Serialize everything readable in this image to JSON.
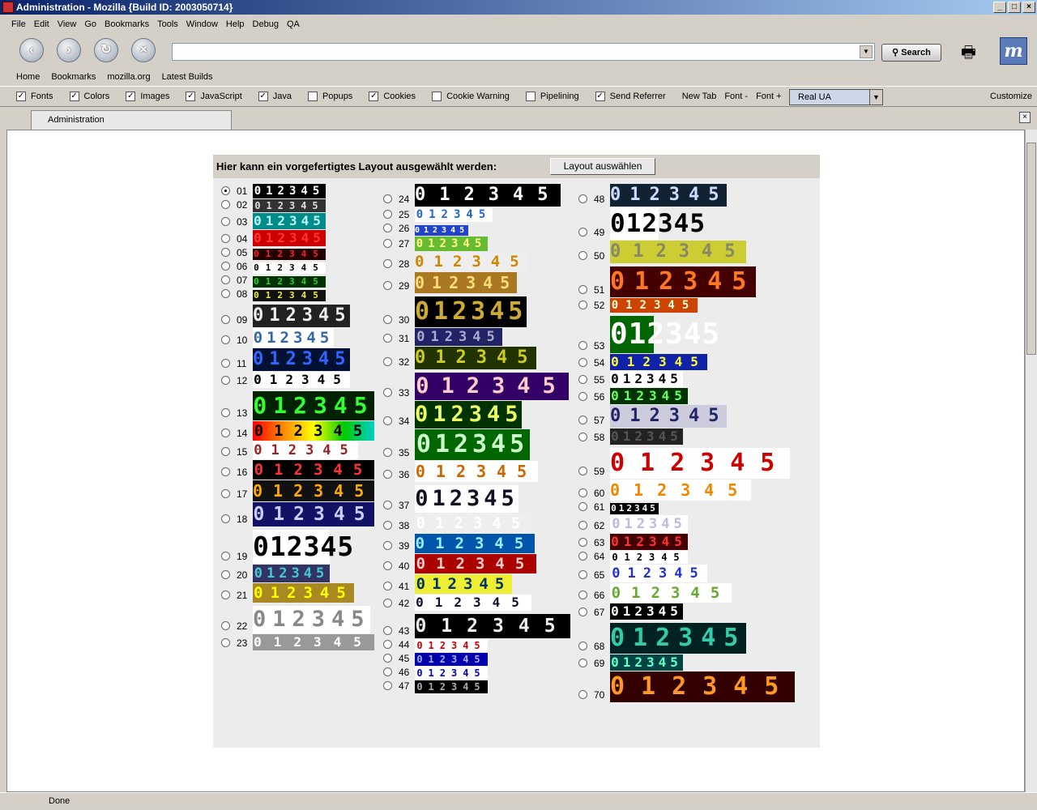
{
  "window": {
    "title": "Administration - Mozilla {Build ID: 2003050714}"
  },
  "menu": [
    "File",
    "Edit",
    "View",
    "Go",
    "Bookmarks",
    "Tools",
    "Window",
    "Help",
    "Debug",
    "QA"
  ],
  "nav": {
    "search_label": "Search"
  },
  "personal_toolbar": [
    "Home",
    "Bookmarks",
    "mozilla.org",
    "Latest Builds"
  ],
  "prefbar": {
    "checkboxes": [
      {
        "label": "Fonts",
        "checked": true
      },
      {
        "label": "Colors",
        "checked": true
      },
      {
        "label": "Images",
        "checked": true
      },
      {
        "label": "JavaScript",
        "checked": true
      },
      {
        "label": "Java",
        "checked": true
      },
      {
        "label": "Popups",
        "checked": false
      },
      {
        "label": "Cookies",
        "checked": true
      },
      {
        "label": "Cookie Warning",
        "checked": false
      },
      {
        "label": "Pipelining",
        "checked": false
      },
      {
        "label": "Send Referrer",
        "checked": true
      }
    ],
    "buttons": [
      "New Tab",
      "Font -",
      "Font +"
    ],
    "ua_select": "Real UA",
    "customize": "Customize"
  },
  "tab": {
    "label": "Administration"
  },
  "page": {
    "header_text": "Hier kann ein vorgefertigtes Layout ausgewählt werden:",
    "layout_button": "Layout auswählen",
    "digits": "012345",
    "selected": "01",
    "columns": [
      [
        "01",
        "02",
        "03",
        "04",
        "05",
        "06",
        "07",
        "08",
        "09",
        "10",
        "11",
        "12",
        "13",
        "14",
        "15",
        "16",
        "17",
        "18",
        "19",
        "20",
        "21",
        "22",
        "23"
      ],
      [
        "24",
        "25",
        "26",
        "27",
        "28",
        "29",
        "30",
        "31",
        "32",
        "33",
        "34",
        "35",
        "36",
        "37",
        "38",
        "39",
        "40",
        "41",
        "42",
        "43",
        "44",
        "45",
        "46",
        "47"
      ],
      [
        "48",
        "49",
        "50",
        "51",
        "52",
        "53",
        "54",
        "55",
        "56",
        "57",
        "58",
        "59",
        "60",
        "61",
        "62",
        "63",
        "64",
        "65",
        "66",
        "67",
        "68",
        "69",
        "70"
      ]
    ]
  },
  "status": {
    "text": "Done"
  }
}
